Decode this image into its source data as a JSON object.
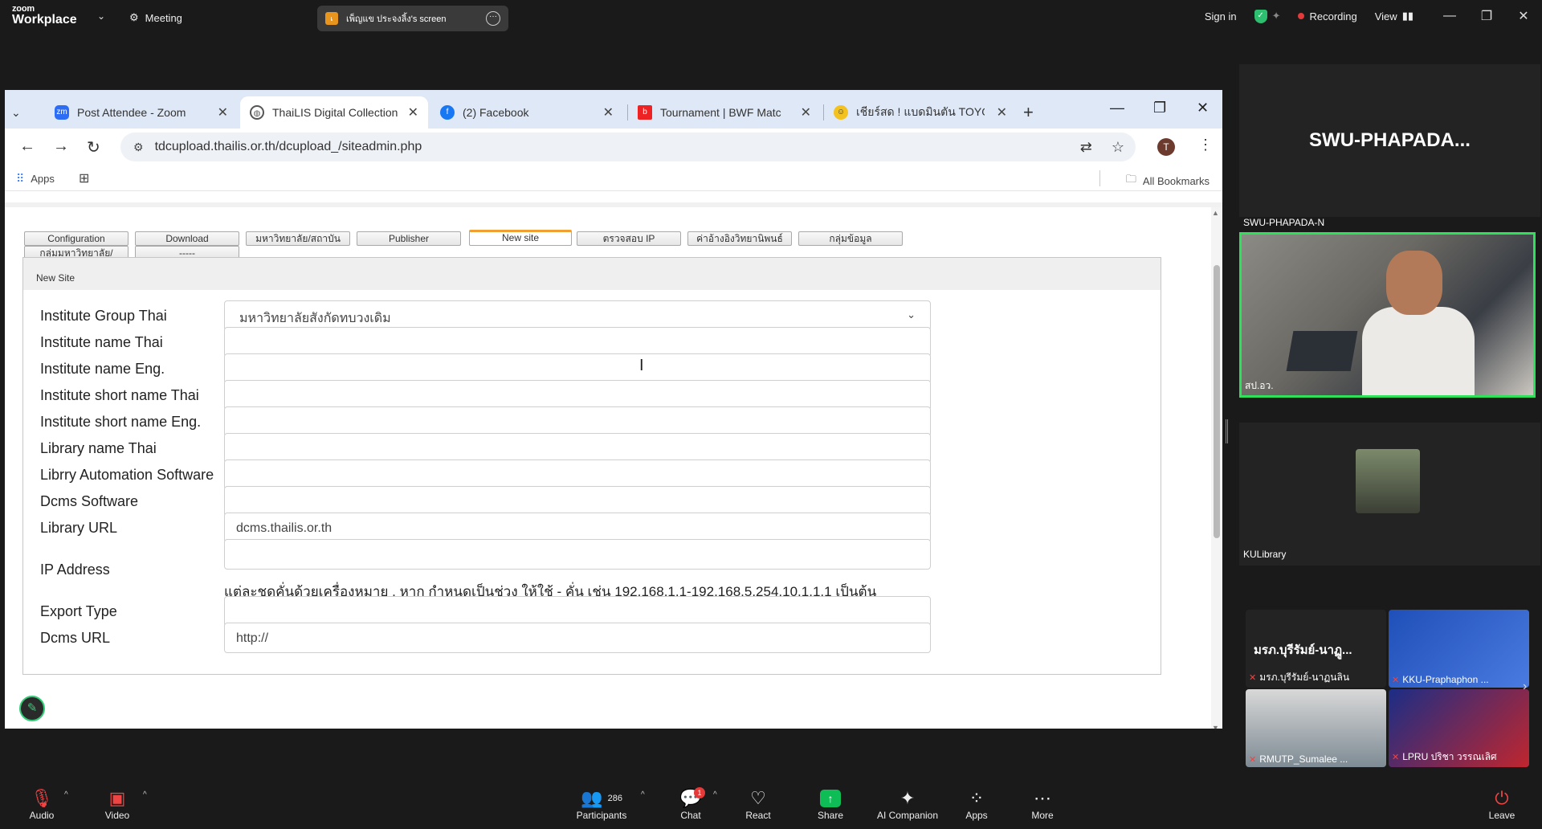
{
  "zoom": {
    "brand_small": "zoom",
    "brand": "Workplace",
    "meeting_label": "Meeting",
    "share_title": "เพ็ญแข ประจงลิ้ง's screen",
    "share_badge": "เ",
    "sign_in": "Sign in",
    "recording": "Recording",
    "view": "View"
  },
  "chrome": {
    "tabs": [
      {
        "title": "Post Attendee - Zoom"
      },
      {
        "title": "ThaiLIS Digital Collection"
      },
      {
        "title": "(2) Facebook"
      },
      {
        "title": "Tournament | BWF Matc"
      },
      {
        "title": "เชียร์สด ! แบดมินตัน TOYOT"
      }
    ],
    "url": "tdcupload.thailis.or.th/dcupload_/siteadmin.php",
    "avatar_letter": "T",
    "bookmarks": {
      "apps": "Apps",
      "all": "All Bookmarks"
    }
  },
  "page": {
    "tabs_row1": [
      "Configuration",
      "Download",
      "มหาวิทยาลัย/สถาบัน",
      "Publisher",
      "New site",
      "ตรวจสอบ IP",
      "ค่าอ้างอิงวิทยานิพนธ์",
      "กลุ่มข้อมูล"
    ],
    "tabs_row2": [
      "กลุ่มมหาวิทยาลัย/สถาบัน",
      "-----"
    ],
    "panel_title": "New Site",
    "fields": [
      {
        "label": "Institute Group Thai",
        "value": "มหาวิทยาลัยสังกัดทบวงเดิม"
      },
      {
        "label": "Institute name Thai",
        "value": ""
      },
      {
        "label": "Institute name Eng.",
        "value": ""
      },
      {
        "label": "Institute short name Thai",
        "value": ""
      },
      {
        "label": "Institute short name Eng.",
        "value": ""
      },
      {
        "label": "Library name Thai",
        "value": ""
      },
      {
        "label": "Librry Automation Software",
        "value": ""
      },
      {
        "label": "Dcms Software",
        "value": ""
      },
      {
        "label": "Library URL",
        "value": "dcms.thailis.or.th"
      },
      {
        "label": "IP Address",
        "value": ""
      },
      {
        "label": "Export Type",
        "value": ""
      },
      {
        "label": "Dcms URL",
        "value": "http://"
      }
    ],
    "ip_hint": "แต่ละชุดคั่นด้วยเครื่องหมาย , หาก กำหนดเป็นช่วง ให้ใช้ - คั่น เช่น 192.168.1.1-192.168.5.254,10.1.1.1 เป็นต้น"
  },
  "participants": {
    "active_speaker": "SWU-PHAPADA...",
    "active_label": "SWU-PHAPADA-N",
    "main_video_label": "สป.อว.",
    "ku_label": "KULibrary",
    "tiles": [
      {
        "title": "มรภ.บุรีรัมย์-นาฏู...",
        "name": "มรภ.บุรีรัมย์-นาฏนลิน"
      },
      {
        "name": "KKU-Praphaphon ..."
      },
      {
        "name": "RMUTP_Sumalee ..."
      },
      {
        "name": "LPRU ปริชา วรรณเลิศ"
      }
    ]
  },
  "toolbar": {
    "audio": "Audio",
    "video": "Video",
    "participants": "Participants",
    "participants_count": "286",
    "chat": "Chat",
    "chat_badge": "1",
    "react": "React",
    "share": "Share",
    "ai": "AI Companion",
    "apps": "Apps",
    "more": "More",
    "leave": "Leave"
  }
}
